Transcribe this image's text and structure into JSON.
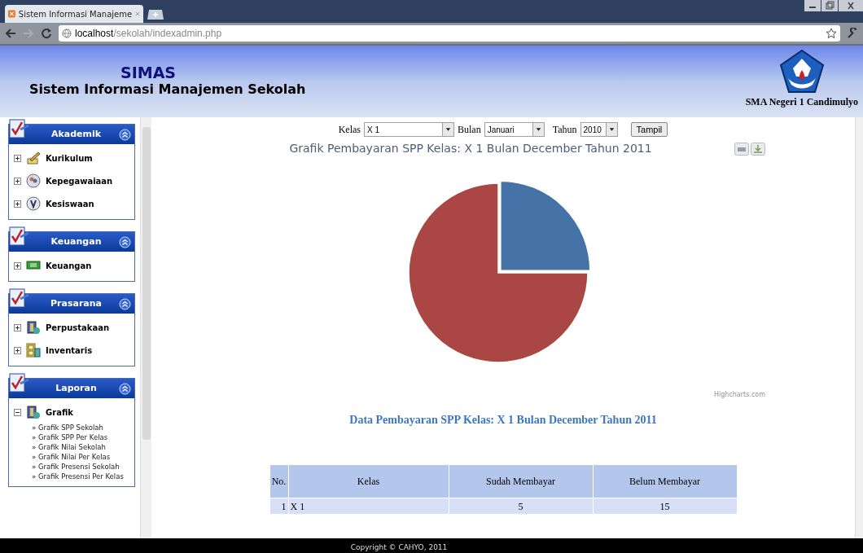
{
  "browser": {
    "tab_title": "Sistem Informasi Manajeme",
    "address_host": "localhost",
    "address_path": "/sekolah/indexadmin.php"
  },
  "header": {
    "app_name": "SIMAS",
    "app_subtitle": "Sistem Informasi Manajemen Sekolah",
    "school_name": "SMA Negeri 1 Candimulyo"
  },
  "sidebar": {
    "panels": [
      {
        "title": "Akademik",
        "items": [
          {
            "label": "Kurikulum",
            "kind": "pencil",
            "expanded": false
          },
          {
            "label": "Kepegawaiaan",
            "kind": "people",
            "expanded": false
          },
          {
            "label": "Kesiswaan",
            "kind": "badge",
            "expanded": false
          }
        ]
      },
      {
        "title": "Keuangan",
        "items": [
          {
            "label": "Keuangan",
            "kind": "money",
            "expanded": false
          }
        ]
      },
      {
        "title": "Prasarana",
        "items": [
          {
            "label": "Perpustakaan",
            "kind": "book",
            "expanded": false
          },
          {
            "label": "Inventaris",
            "kind": "cabinet",
            "expanded": false
          }
        ]
      },
      {
        "title": "Laporan",
        "items": [
          {
            "label": "Grafik",
            "kind": "book",
            "expanded": true,
            "children": [
              "» Grafik SPP Sekolah",
              "» Grafik SPP Per Kelas",
              "» Grafik Nilai Sekolah",
              "» Grafik Nilai Per Kelas",
              "» Grafik Presensi Sekolah",
              "» Grafik Presensi Per Kelas"
            ]
          }
        ]
      }
    ]
  },
  "filter": {
    "kelas_label": "Kelas",
    "kelas_value": "X 1",
    "bulan_label": "Bulan",
    "bulan_value": "Januari",
    "tahun_label": "Tahun",
    "tahun_value": "2010",
    "button": "Tampil"
  },
  "chart": {
    "title": "Grafik Pembayaran SPP Kelas: X 1 Bulan December Tahun 2011",
    "credit": "Highcharts.com"
  },
  "table": {
    "title": "Data Pembayaran SPP Kelas: X 1 Bulan December Tahun 2011",
    "columns": [
      "No.",
      "Kelas",
      "Sudah Membayar",
      "Belum Membayar"
    ],
    "rows": [
      [
        "1",
        "X 1",
        "5",
        "15"
      ]
    ]
  },
  "footer": {
    "text": "Copyright © CAHYO, 2011"
  }
}
